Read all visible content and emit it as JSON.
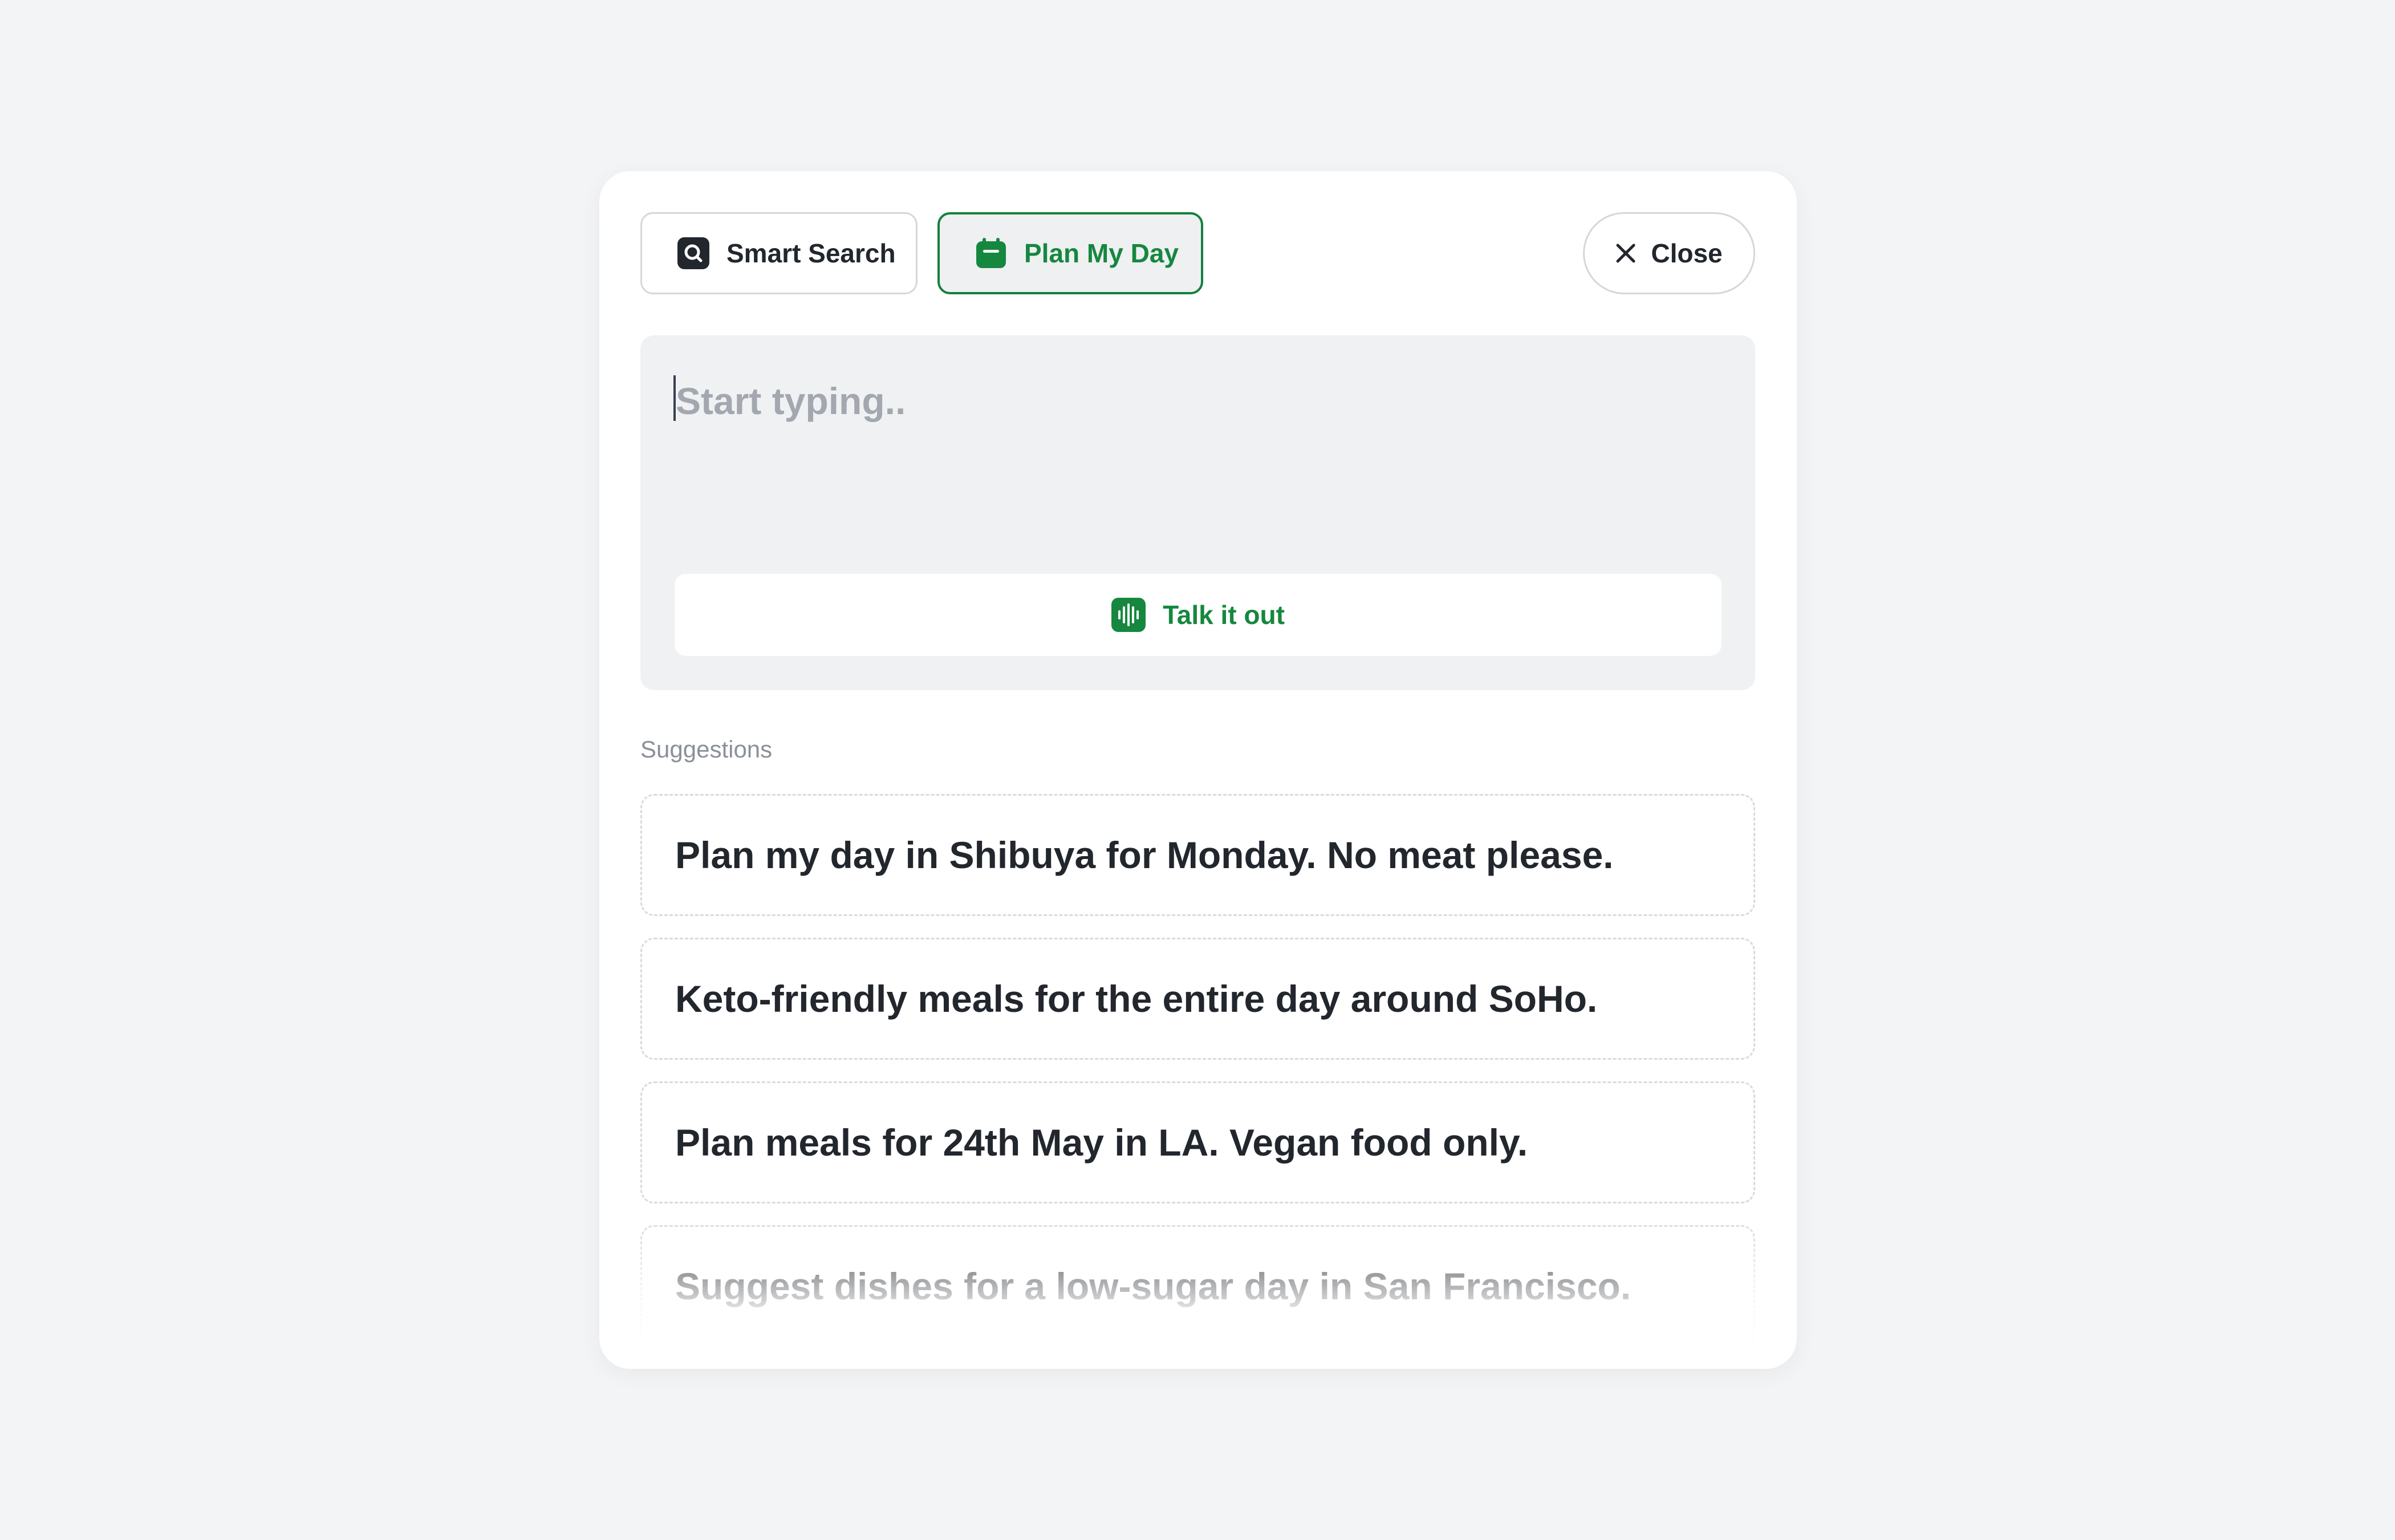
{
  "tabs": {
    "smart_search": {
      "label": "Smart Search",
      "icon": "search-icon"
    },
    "plan_my_day": {
      "label": "Plan My Day",
      "icon": "calendar-icon",
      "active": true
    }
  },
  "close": {
    "label": "Close",
    "icon": "close-icon"
  },
  "input": {
    "placeholder": "Start typing..",
    "value": ""
  },
  "talk": {
    "label": "Talk it out",
    "icon": "audio-waveform-icon"
  },
  "suggestions": {
    "label": "Suggestions",
    "items": [
      "Plan my day in Shibuya for Monday. No meat please.",
      "Keto-friendly meals for the entire day around SoHo.",
      "Plan meals for 24th May in LA. Vegan food only.",
      "Suggest dishes for a low-sugar day in San Francisco."
    ]
  },
  "colors": {
    "accent": "#16873f",
    "text": "#22262d",
    "muted": "#8b9098",
    "background": "#f3f4f6",
    "input_bg": "#f0f1f3"
  }
}
